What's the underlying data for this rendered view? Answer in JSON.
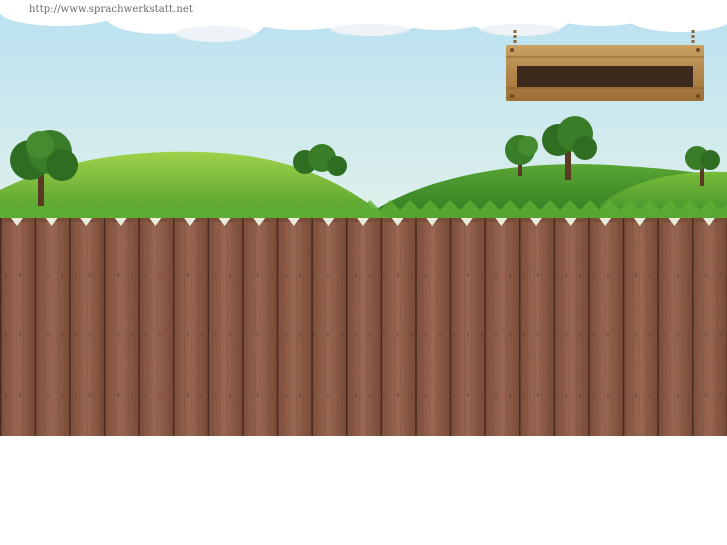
{
  "header": {
    "url_text": "http://www.sprachwerkstatt.net"
  },
  "sign": {
    "label": ""
  },
  "colors": {
    "sky_top": "#bfe3f2",
    "sky_bottom": "#f3f8df",
    "hill_light": "#8cc63f",
    "hill_dark": "#3f8f2a",
    "fence": "#8a5a45",
    "fence_dark": "#5a3528",
    "sign_wood": "#b8864a"
  }
}
